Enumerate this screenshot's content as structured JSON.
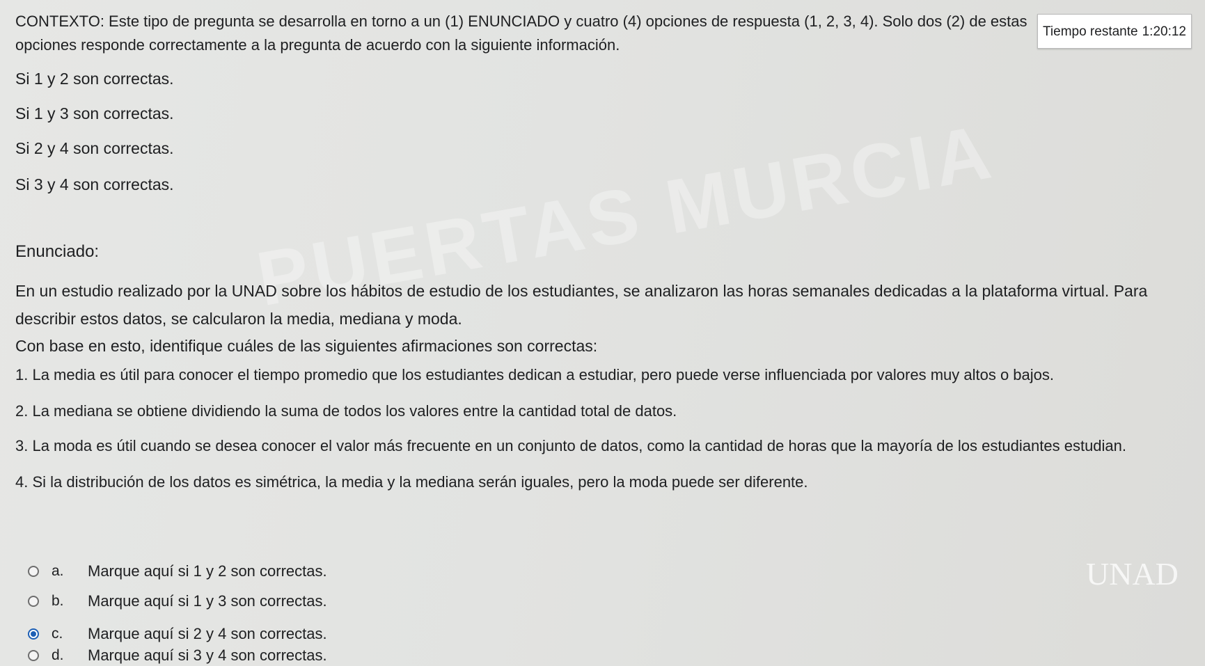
{
  "timer": {
    "label": "Tiempo restante",
    "value": "1:20:12"
  },
  "context": "CONTEXTO: Este tipo de pregunta se desarrolla en torno a un (1) ENUNCIADO y cuatro (4) opciones de respuesta (1, 2, 3, 4). Solo dos (2) de estas opciones responde correctamente a la pregunta de acuerdo con la siguiente información.",
  "codes": [
    "Si 1 y 2 son correctas.",
    "Si 1 y 3 son correctas.",
    "Si 2 y 4 son correctas.",
    "Si 3 y 4 son correctas."
  ],
  "enunciado_label": "Enunciado:",
  "enunciado_text": "En un estudio realizado por la UNAD sobre los hábitos de estudio de los estudiantes, se analizaron las horas semanales dedicadas a la plataforma virtual. Para describir estos datos, se calcularon la media, mediana y moda.",
  "instruction": "Con base en esto, identifique cuáles de las siguientes afirmaciones son correctas:",
  "statements": [
    "1. La media es útil para conocer el tiempo promedio que los estudiantes dedican a estudiar, pero puede verse influenciada por valores muy altos o bajos.",
    "2. La mediana se obtiene dividiendo la suma de todos los valores entre la cantidad total de datos.",
    "3. La moda es útil cuando se desea conocer el valor más frecuente en un conjunto de datos, como la cantidad de horas que la mayoría de los estudiantes estudian.",
    "4. Si la distribución de los datos es simétrica, la media y la mediana serán iguales, pero la moda puede ser diferente."
  ],
  "options": [
    {
      "letter": "a.",
      "text": "Marque aquí si 1 y 2 son correctas.",
      "selected": false
    },
    {
      "letter": "b.",
      "text": "Marque aquí si 1 y 3 son correctas.",
      "selected": false
    },
    {
      "letter": "c.",
      "text": "Marque aquí si 2 y 4 son correctas.",
      "selected": true
    },
    {
      "letter": "d.",
      "text": "Marque aquí si 3 y 4 son correctas.",
      "selected": false
    }
  ],
  "watermark": "PUERTAS MURCIA",
  "logo": "UNAD"
}
